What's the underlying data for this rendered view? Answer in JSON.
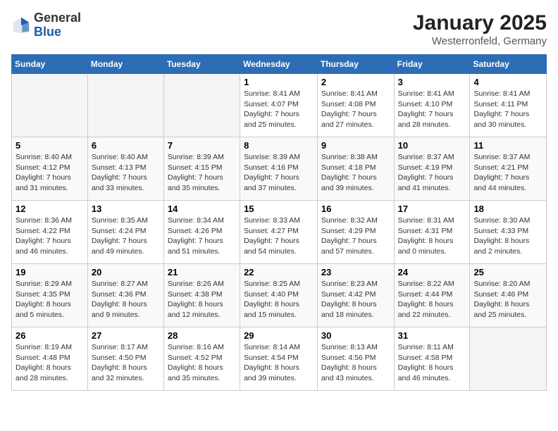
{
  "logo": {
    "general": "General",
    "blue": "Blue"
  },
  "title": "January 2025",
  "location": "Westerronfeld, Germany",
  "weekdays": [
    "Sunday",
    "Monday",
    "Tuesday",
    "Wednesday",
    "Thursday",
    "Friday",
    "Saturday"
  ],
  "weeks": [
    [
      {
        "day": "",
        "info": ""
      },
      {
        "day": "",
        "info": ""
      },
      {
        "day": "",
        "info": ""
      },
      {
        "day": "1",
        "info": "Sunrise: 8:41 AM\nSunset: 4:07 PM\nDaylight: 7 hours\nand 25 minutes."
      },
      {
        "day": "2",
        "info": "Sunrise: 8:41 AM\nSunset: 4:08 PM\nDaylight: 7 hours\nand 27 minutes."
      },
      {
        "day": "3",
        "info": "Sunrise: 8:41 AM\nSunset: 4:10 PM\nDaylight: 7 hours\nand 28 minutes."
      },
      {
        "day": "4",
        "info": "Sunrise: 8:41 AM\nSunset: 4:11 PM\nDaylight: 7 hours\nand 30 minutes."
      }
    ],
    [
      {
        "day": "5",
        "info": "Sunrise: 8:40 AM\nSunset: 4:12 PM\nDaylight: 7 hours\nand 31 minutes."
      },
      {
        "day": "6",
        "info": "Sunrise: 8:40 AM\nSunset: 4:13 PM\nDaylight: 7 hours\nand 33 minutes."
      },
      {
        "day": "7",
        "info": "Sunrise: 8:39 AM\nSunset: 4:15 PM\nDaylight: 7 hours\nand 35 minutes."
      },
      {
        "day": "8",
        "info": "Sunrise: 8:39 AM\nSunset: 4:16 PM\nDaylight: 7 hours\nand 37 minutes."
      },
      {
        "day": "9",
        "info": "Sunrise: 8:38 AM\nSunset: 4:18 PM\nDaylight: 7 hours\nand 39 minutes."
      },
      {
        "day": "10",
        "info": "Sunrise: 8:37 AM\nSunset: 4:19 PM\nDaylight: 7 hours\nand 41 minutes."
      },
      {
        "day": "11",
        "info": "Sunrise: 8:37 AM\nSunset: 4:21 PM\nDaylight: 7 hours\nand 44 minutes."
      }
    ],
    [
      {
        "day": "12",
        "info": "Sunrise: 8:36 AM\nSunset: 4:22 PM\nDaylight: 7 hours\nand 46 minutes."
      },
      {
        "day": "13",
        "info": "Sunrise: 8:35 AM\nSunset: 4:24 PM\nDaylight: 7 hours\nand 49 minutes."
      },
      {
        "day": "14",
        "info": "Sunrise: 8:34 AM\nSunset: 4:26 PM\nDaylight: 7 hours\nand 51 minutes."
      },
      {
        "day": "15",
        "info": "Sunrise: 8:33 AM\nSunset: 4:27 PM\nDaylight: 7 hours\nand 54 minutes."
      },
      {
        "day": "16",
        "info": "Sunrise: 8:32 AM\nSunset: 4:29 PM\nDaylight: 7 hours\nand 57 minutes."
      },
      {
        "day": "17",
        "info": "Sunrise: 8:31 AM\nSunset: 4:31 PM\nDaylight: 8 hours\nand 0 minutes."
      },
      {
        "day": "18",
        "info": "Sunrise: 8:30 AM\nSunset: 4:33 PM\nDaylight: 8 hours\nand 2 minutes."
      }
    ],
    [
      {
        "day": "19",
        "info": "Sunrise: 8:29 AM\nSunset: 4:35 PM\nDaylight: 8 hours\nand 5 minutes."
      },
      {
        "day": "20",
        "info": "Sunrise: 8:27 AM\nSunset: 4:36 PM\nDaylight: 8 hours\nand 9 minutes."
      },
      {
        "day": "21",
        "info": "Sunrise: 8:26 AM\nSunset: 4:38 PM\nDaylight: 8 hours\nand 12 minutes."
      },
      {
        "day": "22",
        "info": "Sunrise: 8:25 AM\nSunset: 4:40 PM\nDaylight: 8 hours\nand 15 minutes."
      },
      {
        "day": "23",
        "info": "Sunrise: 8:23 AM\nSunset: 4:42 PM\nDaylight: 8 hours\nand 18 minutes."
      },
      {
        "day": "24",
        "info": "Sunrise: 8:22 AM\nSunset: 4:44 PM\nDaylight: 8 hours\nand 22 minutes."
      },
      {
        "day": "25",
        "info": "Sunrise: 8:20 AM\nSunset: 4:46 PM\nDaylight: 8 hours\nand 25 minutes."
      }
    ],
    [
      {
        "day": "26",
        "info": "Sunrise: 8:19 AM\nSunset: 4:48 PM\nDaylight: 8 hours\nand 28 minutes."
      },
      {
        "day": "27",
        "info": "Sunrise: 8:17 AM\nSunset: 4:50 PM\nDaylight: 8 hours\nand 32 minutes."
      },
      {
        "day": "28",
        "info": "Sunrise: 8:16 AM\nSunset: 4:52 PM\nDaylight: 8 hours\nand 35 minutes."
      },
      {
        "day": "29",
        "info": "Sunrise: 8:14 AM\nSunset: 4:54 PM\nDaylight: 8 hours\nand 39 minutes."
      },
      {
        "day": "30",
        "info": "Sunrise: 8:13 AM\nSunset: 4:56 PM\nDaylight: 8 hours\nand 43 minutes."
      },
      {
        "day": "31",
        "info": "Sunrise: 8:11 AM\nSunset: 4:58 PM\nDaylight: 8 hours\nand 46 minutes."
      },
      {
        "day": "",
        "info": ""
      }
    ]
  ]
}
